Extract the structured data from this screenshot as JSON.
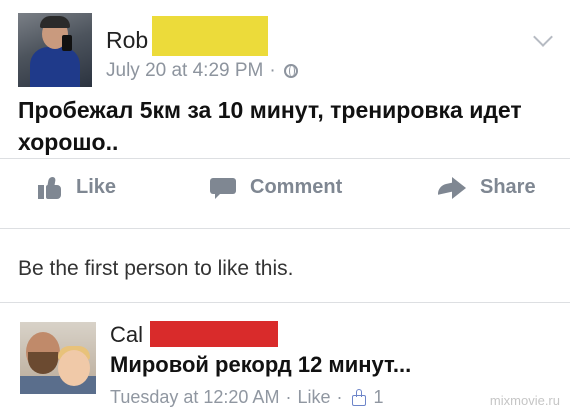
{
  "post": {
    "author_name": "Rob",
    "timestamp": "July 20 at 4:29 PM",
    "meta_separator": "·",
    "privacy_icon": "globe-icon",
    "menu_icon": "chevron-down-icon",
    "text": "Пробежал 5км за 10 минут, тренировка идет хорошо.."
  },
  "actions": {
    "like_label": "Like",
    "comment_label": "Comment",
    "share_label": "Share"
  },
  "likes_summary": "Be the first person to like this.",
  "comment": {
    "author_name": "Cal",
    "text": "Мировой рекорд 12 минут...",
    "timestamp": "Tuesday at 12:20 AM",
    "separator": "·",
    "like_label": "Like",
    "like_count": "1"
  },
  "watermark": "mixmovie.ru",
  "colors": {
    "redaction_yellow": "#ecdb3a",
    "redaction_red": "#d92b2b",
    "meta_gray": "#8d949e",
    "like_blue": "#6d85c9"
  }
}
